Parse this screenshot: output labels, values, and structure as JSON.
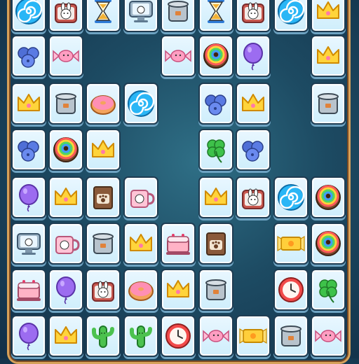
{
  "game": {
    "tile_types": {
      "swirl": "blue-swirl-lollipop-icon",
      "bunny-box": "bunny-tin-box-icon",
      "hourglass": "hourglass-icon",
      "monitor": "bunny-monitor-icon",
      "pot": "metal-pot-icon",
      "crown": "gold-crown-icon",
      "blueberries": "blueberries-icon",
      "candy": "wrapped-candy-icon",
      "rainbow-donut": "rainbow-donut-icon",
      "balloon": "purple-balloon-icon",
      "donut": "pink-donut-icon",
      "clover": "four-leaf-clover-icon",
      "cookie-bag": "paw-cookie-bag-icon",
      "mug": "bunny-mug-icon",
      "cake": "pink-cake-icon",
      "yellow-candy": "yellow-candy-icon",
      "clock": "red-clock-icon",
      "cactus": "cactus-icon"
    },
    "board_rows": [
      [
        "swirl",
        "bunny-box",
        "hourglass",
        "monitor",
        "pot",
        "hourglass",
        "bunny-box",
        "swirl",
        "crown"
      ],
      [
        "blueberries",
        "candy",
        null,
        null,
        "candy",
        "rainbow-donut",
        "balloon",
        null,
        "crown"
      ],
      [
        "crown",
        "pot",
        "donut",
        "swirl",
        null,
        "blueberries",
        "crown",
        null,
        "pot"
      ],
      [
        "blueberries",
        "rainbow-donut",
        "crown",
        null,
        null,
        "clover",
        "blueberries",
        null,
        null
      ],
      [
        "balloon",
        "crown",
        "cookie-bag",
        "mug",
        null,
        "crown",
        "bunny-box",
        "swirl",
        "rainbow-donut"
      ],
      [
        "monitor",
        "mug",
        "pot",
        "crown",
        "cake",
        "cookie-bag",
        null,
        "yellow-candy",
        "rainbow-donut"
      ],
      [
        "cake",
        "balloon",
        "bunny-box",
        "donut",
        "crown",
        "pot",
        null,
        "clock",
        "clover"
      ],
      [
        "balloon",
        "crown",
        "cactus",
        "cactus",
        "clock",
        "candy",
        "yellow-candy",
        "pot",
        "candy"
      ]
    ]
  }
}
